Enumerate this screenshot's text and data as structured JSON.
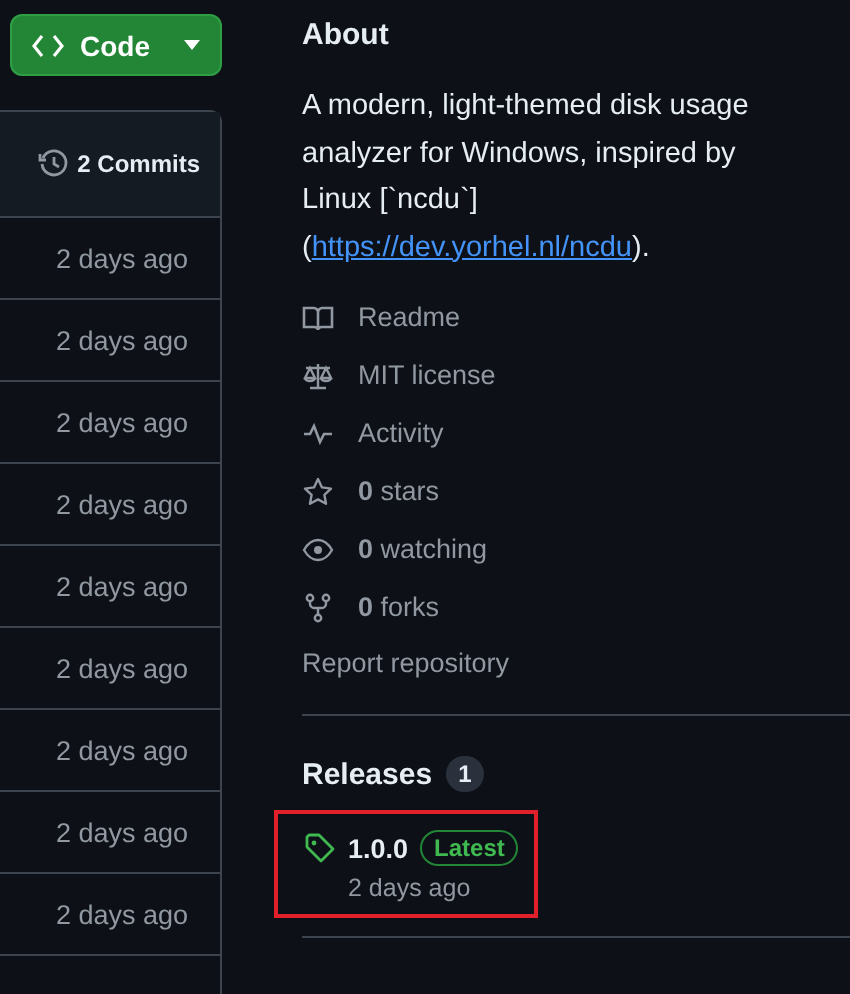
{
  "code_button": {
    "label": "Code"
  },
  "file_list": {
    "commits": "2 Commits",
    "rows": [
      {
        "time": "2 days ago"
      },
      {
        "time": "2 days ago"
      },
      {
        "time": "2 days ago"
      },
      {
        "time": "2 days ago"
      },
      {
        "time": "2 days ago"
      },
      {
        "time": "2 days ago"
      },
      {
        "time": "2 days ago"
      },
      {
        "time": "2 days ago"
      },
      {
        "time": "2 days ago"
      }
    ]
  },
  "about": {
    "title": "About",
    "description": "A modern, light-themed disk usage analyzer for Windows, inspired by Linux [`ncdu`]",
    "link_open": "(",
    "link": "https://dev.yorhel.nl/ncdu",
    "link_close": ").",
    "links": [
      {
        "kind": "readme",
        "label": "Readme"
      },
      {
        "kind": "license",
        "label": "MIT license"
      },
      {
        "kind": "activity",
        "label": "Activity"
      },
      {
        "kind": "stars",
        "count": "0",
        "label": "stars"
      },
      {
        "kind": "watching",
        "count": "0",
        "label": "watching"
      },
      {
        "kind": "forks",
        "count": "0",
        "label": "forks"
      }
    ],
    "report": "Report repository"
  },
  "releases": {
    "title": "Releases",
    "count": "1",
    "items": [
      {
        "version": "1.0.0",
        "badge": "Latest",
        "date": "2 days ago",
        "highlighted": true
      }
    ]
  }
}
